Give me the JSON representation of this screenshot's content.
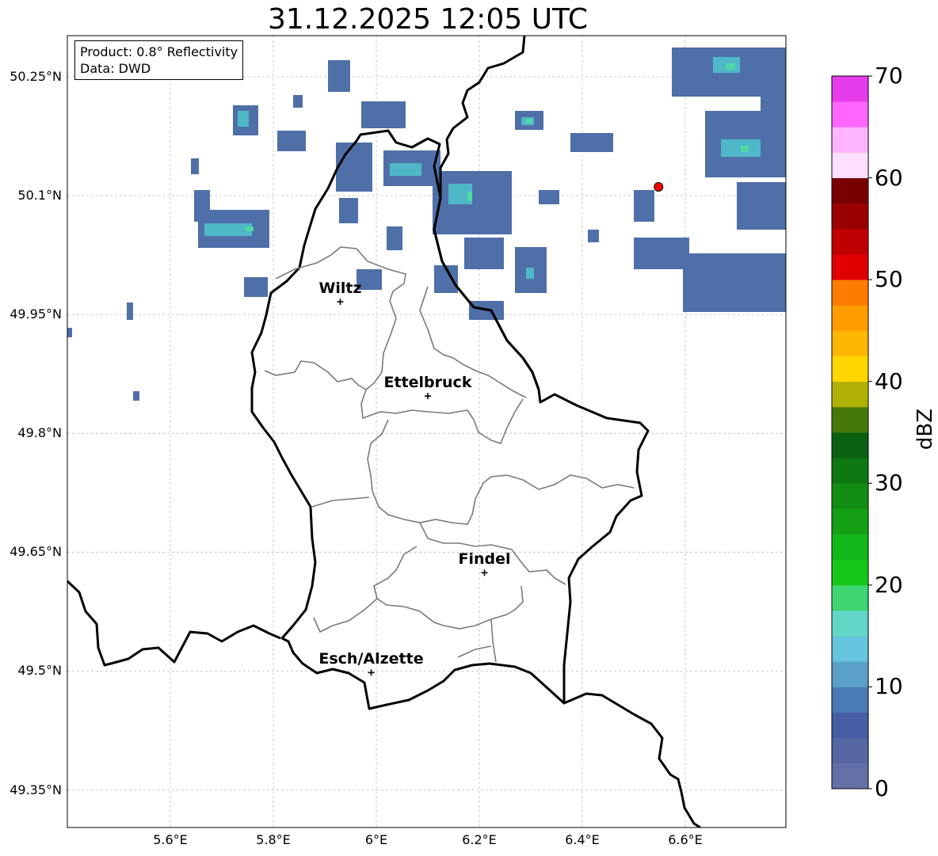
{
  "title": "31.12.2025 12:05 UTC",
  "info": {
    "product": "Product: 0.8° Reflectivity",
    "data": "Data: DWD"
  },
  "cities": [
    {
      "name": "Wiltz",
      "lon": 5.93,
      "lat": 49.966
    },
    {
      "name": "Ettelbruck",
      "lon": 6.1,
      "lat": 49.847
    },
    {
      "name": "Findel",
      "lon": 6.21,
      "lat": 49.624
    },
    {
      "name": "Esch/Alzette",
      "lon": 5.99,
      "lat": 49.498
    }
  ],
  "radar_site": {
    "lon": 6.548,
    "lat": 50.111,
    "color": "#ff0000"
  },
  "lat_labels": [
    "50.25°N",
    "50.1°N",
    "49.95°N",
    "49.8°N",
    "49.65°N",
    "49.5°N",
    "49.35°N"
  ],
  "lat_values": [
    50.25,
    50.1,
    49.95,
    49.8,
    49.65,
    49.5,
    49.35
  ],
  "lon_labels": [
    "5.6°E",
    "5.8°E",
    "6°E",
    "6.2°E",
    "6.4°E",
    "6.6°E"
  ],
  "lon_values": [
    5.6,
    5.8,
    6.0,
    6.2,
    6.4,
    6.6
  ],
  "colorbar": {
    "label": "dBZ",
    "ticks": [
      "0",
      "10",
      "20",
      "30",
      "40",
      "50",
      "60",
      "70"
    ],
    "colors": [
      "#6470a8",
      "#5666a2",
      "#465ea4",
      "#4a7bb6",
      "#5aa0c8",
      "#66c4dc",
      "#62d6c6",
      "#3ed670",
      "#14c81a",
      "#12b81a",
      "#14a014",
      "#128e14",
      "#0e7812",
      "#086010",
      "#457a0a",
      "#b0b004",
      "#ffd600",
      "#ffb600",
      "#ff9c00",
      "#ff7c00",
      "#e00000",
      "#c00000",
      "#9a0000",
      "#780000",
      "#ffdfff",
      "#ffb4ff",
      "#ff66ff",
      "#e63ceb"
    ]
  }
}
